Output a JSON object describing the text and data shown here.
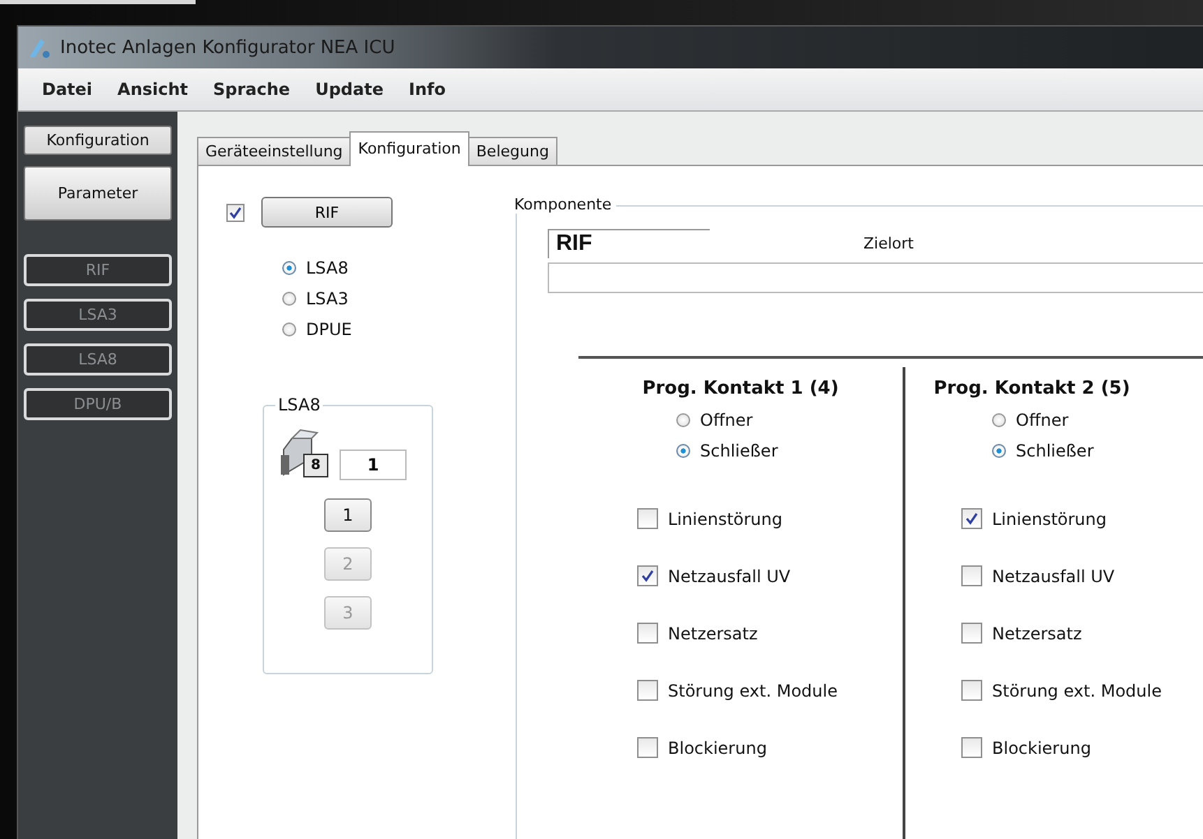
{
  "window": {
    "title": "Inotec Anlagen Konfigurator NEA ICU"
  },
  "menu": [
    "Datei",
    "Ansicht",
    "Sprache",
    "Update",
    "Info"
  ],
  "sidebar": {
    "buttons": [
      {
        "label": "Konfiguration",
        "selected": true
      },
      {
        "label": "Parameter",
        "selected": false
      }
    ],
    "items": [
      "RIF",
      "LSA3",
      "LSA8",
      "DPU/B"
    ]
  },
  "tabs": [
    {
      "label": "Geräteeinstellung",
      "selected": false
    },
    {
      "label": "Konfiguration",
      "selected": true
    },
    {
      "label": "Belegung",
      "selected": false
    }
  ],
  "rif": {
    "checked": true,
    "button": "RIF"
  },
  "types": [
    {
      "label": "LSA8",
      "selected": true
    },
    {
      "label": "LSA3",
      "selected": false
    },
    {
      "label": "DPUE",
      "selected": false
    }
  ],
  "lsa8_group": {
    "title": "LSA8",
    "icon_badge": "8",
    "value": "1",
    "buttons": [
      {
        "label": "1",
        "disabled": false
      },
      {
        "label": "2",
        "disabled": true
      },
      {
        "label": "3",
        "disabled": true
      }
    ]
  },
  "komponente": {
    "title": "Komponente",
    "name": "RIF",
    "zielort_label": "Zielort",
    "contacts": [
      {
        "title": "Prog. Kontakt 1 (4)",
        "modes": [
          {
            "label": "Offner",
            "selected": false
          },
          {
            "label": "Schließer",
            "selected": true
          }
        ],
        "options": [
          {
            "label": "Linienstörung",
            "checked": false
          },
          {
            "label": "Netzausfall UV",
            "checked": true
          },
          {
            "label": "Netzersatz",
            "checked": false
          },
          {
            "label": "Störung ext. Module",
            "checked": false
          },
          {
            "label": "Blockierung",
            "checked": false
          }
        ]
      },
      {
        "title": "Prog. Kontakt 2 (5)",
        "modes": [
          {
            "label": "Offner",
            "selected": false
          },
          {
            "label": "Schließer",
            "selected": true
          }
        ],
        "options": [
          {
            "label": "Linienstörung",
            "checked": true
          },
          {
            "label": "Netzausfall UV",
            "checked": false
          },
          {
            "label": "Netzersatz",
            "checked": false
          },
          {
            "label": "Störung ext. Module",
            "checked": false
          },
          {
            "label": "Blockierung",
            "checked": false
          }
        ]
      }
    ]
  }
}
